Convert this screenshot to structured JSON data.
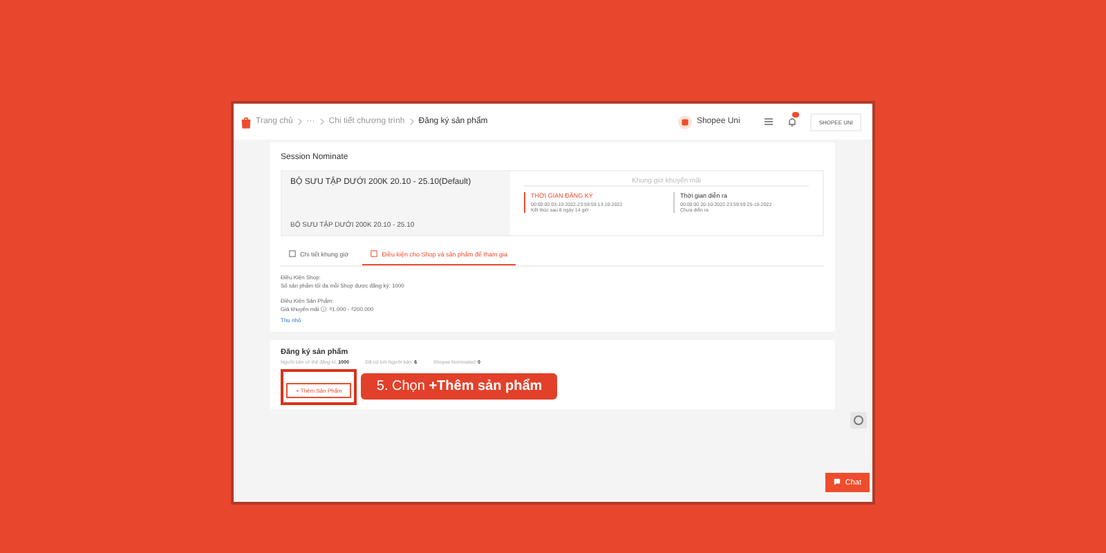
{
  "header": {
    "breadcrumb": [
      {
        "label": "Trang chủ",
        "current": false
      },
      {
        "label": "···",
        "current": false
      },
      {
        "label": "Chi tiết chương trình",
        "current": false
      },
      {
        "label": "Đăng ký sản phẩm",
        "current": true
      }
    ],
    "shop_name": "Shopee Uni",
    "account": "SHOPEE UNI"
  },
  "session": {
    "title": "Session Nominate",
    "name": "BỘ SƯU TẬP DƯỚI 200K 20.10 - 25.10(Default)",
    "subtitle": "BỘ SƯU TẬP DƯỚI 200K 20.10 - 25.10",
    "timeline_title": "Khung giờ khuyến mãi",
    "steps": [
      {
        "label": "THỜI GIAN ĐĂNG KÝ",
        "range": "00:00:00 03-10-2022-23:59:59 13-10-2022",
        "note": "Kết thúc sau 8 ngày 14 giờ",
        "active": true
      },
      {
        "label": "Thời gian diễn ra",
        "range": "00:00:00 20-10-2022-23:59:59 25-10-2022",
        "note": "Chưa diễn ra",
        "active": false
      }
    ]
  },
  "tabs": [
    {
      "label": "Chi tiết khung giờ",
      "selected": false
    },
    {
      "label": "Điều kiện cho Shop và sản phẩm để tham gia",
      "selected": true
    }
  ],
  "conditions": [
    {
      "heading": "Điều Kiện Shop:",
      "lines": [
        "Số sản phẩm tối đa mỗi Shop được đăng ký: 1000"
      ]
    },
    {
      "heading": "Điều Kiện Sản Phẩm:",
      "lines": [
        "Giá khuyến mãi ⓘ: ₫1.000 - ₫200.000"
      ]
    }
  ],
  "collapse_link": "Thu nhỏ",
  "register": {
    "title": "Đăng ký sản phẩm",
    "stats": [
      {
        "label": "Người bán có thể đăng kí:",
        "value": "1000"
      },
      {
        "label": "Đã cử bởi Người bán:",
        "value": "6"
      },
      {
        "label": "Shopee Nominated:",
        "value": "0"
      }
    ],
    "add_button": "+ Thêm Sản Phẩm"
  },
  "callout": "5. Chọn **+Thêm sản phẩm**",
  "chat": {
    "label": "Chat"
  }
}
